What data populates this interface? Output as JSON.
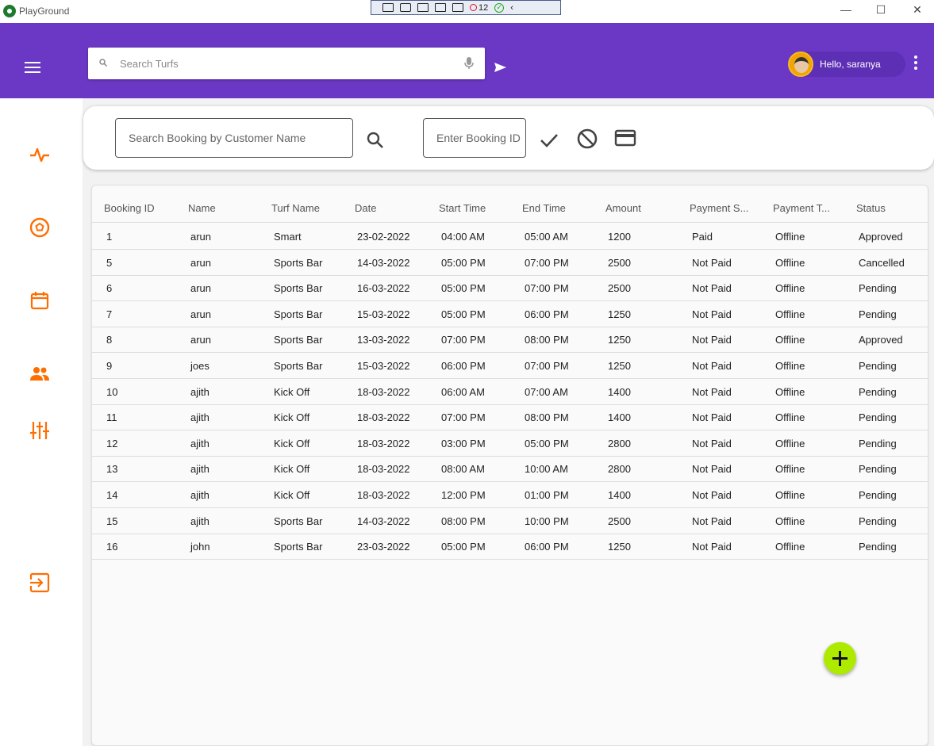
{
  "app": {
    "title": "PlayGround"
  },
  "debug_toolbar": {
    "counter": "12"
  },
  "header": {
    "search": {
      "placeholder": "Search Turfs",
      "value": ""
    },
    "greeting": "Hello, saranya"
  },
  "filters": {
    "customer_search": {
      "placeholder": "Search Booking by Customer Name",
      "value": ""
    },
    "booking_id": {
      "placeholder": "Enter Booking ID",
      "value": ""
    }
  },
  "sidebar": {
    "items": [
      {
        "icon": "activity-icon"
      },
      {
        "icon": "football-icon"
      },
      {
        "icon": "calendar-icon"
      },
      {
        "icon": "users-icon"
      },
      {
        "icon": "sliders-icon"
      },
      {
        "icon": "logout-icon"
      }
    ],
    "accent": "#ff6d00"
  },
  "colors": {
    "header": "#6a38c4",
    "fab": "#aeea00",
    "icon_accent": "#ff6d00"
  },
  "table": {
    "columns": [
      "Booking ID",
      "Name",
      "Turf Name",
      "Date",
      "Start Time",
      "End Time",
      "Amount",
      "Payment S...",
      "Payment T...",
      "Status"
    ],
    "rows": [
      [
        "1",
        "arun",
        "Smart",
        "23-02-2022",
        "04:00 AM",
        "05:00 AM",
        "1200",
        "Paid",
        "Offline",
        "Approved"
      ],
      [
        "5",
        "arun",
        "Sports Bar",
        "14-03-2022",
        "05:00 PM",
        "07:00 PM",
        "2500",
        "Not Paid",
        "Offline",
        "Cancelled"
      ],
      [
        "6",
        "arun",
        "Sports Bar",
        "16-03-2022",
        "05:00 PM",
        "07:00 PM",
        "2500",
        "Not Paid",
        "Offline",
        "Pending"
      ],
      [
        "7",
        "arun",
        "Sports Bar",
        "15-03-2022",
        "05:00 PM",
        "06:00 PM",
        "1250",
        "Not Paid",
        "Offline",
        "Pending"
      ],
      [
        "8",
        "arun",
        "Sports Bar",
        "13-03-2022",
        "07:00 PM",
        "08:00 PM",
        "1250",
        "Not Paid",
        "Offline",
        "Approved"
      ],
      [
        "9",
        "joes",
        "Sports Bar",
        "15-03-2022",
        "06:00 PM",
        "07:00 PM",
        "1250",
        "Not Paid",
        "Offline",
        "Pending"
      ],
      [
        "10",
        "ajith",
        "Kick Off",
        "18-03-2022",
        "06:00 AM",
        "07:00 AM",
        "1400",
        "Not Paid",
        "Offline",
        "Pending"
      ],
      [
        "11",
        "ajith",
        "Kick Off",
        "18-03-2022",
        "07:00 PM",
        "08:00 PM",
        "1400",
        "Not Paid",
        "Offline",
        "Pending"
      ],
      [
        "12",
        "ajith",
        "Kick Off",
        "18-03-2022",
        "03:00 PM",
        "05:00 PM",
        "2800",
        "Not Paid",
        "Offline",
        "Pending"
      ],
      [
        "13",
        "ajith",
        "Kick Off",
        "18-03-2022",
        "08:00 AM",
        "10:00 AM",
        "2800",
        "Not Paid",
        "Offline",
        "Pending"
      ],
      [
        "14",
        "ajith",
        "Kick Off",
        "18-03-2022",
        "12:00 PM",
        "01:00 PM",
        "1400",
        "Not Paid",
        "Offline",
        "Pending"
      ],
      [
        "15",
        "ajith",
        "Sports Bar",
        "14-03-2022",
        "08:00 PM",
        "10:00 PM",
        "2500",
        "Not Paid",
        "Offline",
        "Pending"
      ],
      [
        "16",
        "john",
        "Sports Bar",
        "23-03-2022",
        "05:00 PM",
        "06:00 PM",
        "1250",
        "Not Paid",
        "Offline",
        "Pending"
      ]
    ]
  }
}
